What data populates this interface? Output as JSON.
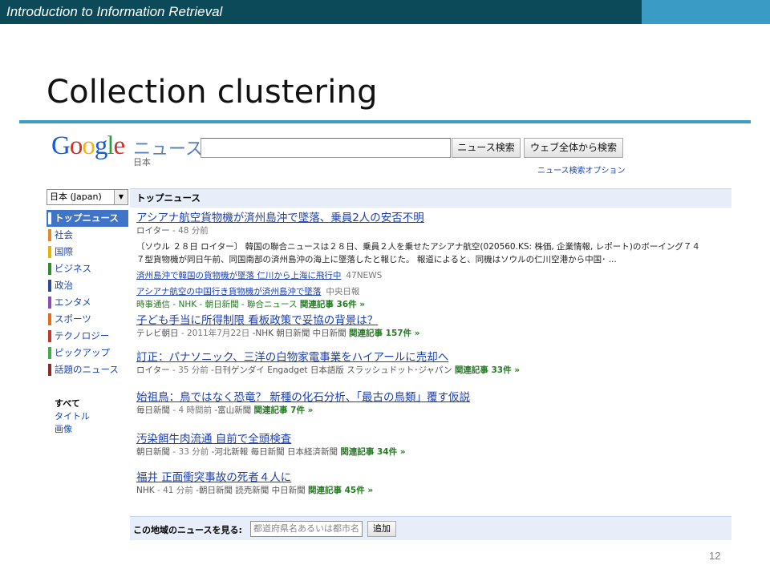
{
  "slide": {
    "course_title": "Introduction to Information Retrieval",
    "title": "Collection clustering",
    "page_number": "12",
    "colors": {
      "bar": "#0c4a5a",
      "accent": "#3a9cc4"
    }
  },
  "google_news": {
    "logo": "Google",
    "section": "ニュース",
    "edition": "日本",
    "search_value": "",
    "news_search_button": "ニュース検索",
    "web_search_button": "ウェブ全体から検索",
    "search_options_link": "ニュース検索オプション",
    "edition_select": "日本 (Japan)",
    "nav": [
      {
        "label": "トップニュース",
        "color": "#3f74c8",
        "active": true
      },
      {
        "label": "社会",
        "color": "#e08a2b"
      },
      {
        "label": "国際",
        "color": "#e8b400"
      },
      {
        "label": "ビジネス",
        "color": "#2e8b2e"
      },
      {
        "label": "政治",
        "color": "#2c4a9c"
      },
      {
        "label": "エンタメ",
        "color": "#8a4fb0"
      },
      {
        "label": "スポーツ",
        "color": "#e86a1c"
      },
      {
        "label": "テクノロジー",
        "color": "#c0392b"
      },
      {
        "label": "ピックアップ",
        "color": "#3fae49"
      },
      {
        "label": "話題のニュース",
        "color": "#8b2a2a"
      }
    ],
    "view_options": [
      "すべて",
      "タイトル",
      "画像"
    ],
    "top_news_header": "トップニュース",
    "stories": [
      {
        "title": "アシアナ航空貨物機が済州島沖で墜落、乗員2人の安否不明",
        "source": "ロイター",
        "time": "48 分前",
        "snippet_1": "〔ソウル ２８日 ロイター〕 韓国の聯合ニュースは２８日、乗員２人を乗せたアシアナ航空(020560.KS: 株価, 企業情報, レポート)のボーイング７４",
        "snippet_2": "７型貨物機が同日午前、同国南部の済州島沖の海上に墜落したと報じた。 報道によると、同機はソウルの仁川空港から中国･ ...",
        "sub_links": [
          {
            "text": "済州島沖で韓国の貨物機が墜落 仁川から上海に飛行中",
            "source": "47NEWS"
          },
          {
            "text": "アシアナ航空の中国行き貨物機が済州島沖で墜落",
            "source": "中央日報"
          }
        ],
        "other_sources": "時事通信 - NHK - 朝日新聞 - 聯合ニュース",
        "related": "関連記事 36件 »"
      },
      {
        "title": "子ども手当に所得制限 看板政策で妥協の背景は？",
        "source": "テレビ朝日",
        "time": "2011年7月22日",
        "more_sources": "-NHK  朝日新聞  中日新聞",
        "related": "関連記事 157件 »"
      },
      {
        "title": "訂正：パナソニック、三洋の白物家電事業をハイアールに売却へ",
        "source": "ロイター",
        "time": "35 分前",
        "more_sources": "-日刊ゲンダイ  Engadget 日本語版  スラッシュドット･ジャパン",
        "related": "関連記事 33件 »"
      },
      {
        "title": "始祖鳥：鳥ではなく恐竜？ 新種の化石分析、「最古の鳥類」覆す仮説",
        "source": "毎日新聞",
        "time": "4 時間前",
        "more_sources": "-富山新聞",
        "related": "関連記事 7件 »"
      },
      {
        "title": "汚染餌牛肉流通 自前で全頭検査",
        "source": "朝日新聞",
        "time": "33 分前",
        "more_sources": "-河北新報  毎日新聞  日本経済新聞",
        "related": "関連記事 34件 »"
      },
      {
        "title": "福井 正面衝突事故の死者４人に",
        "source": "NHK",
        "time": "41 分前",
        "more_sources": "-朝日新聞  読売新聞  中日新聞",
        "related": "関連記事 45件 »"
      }
    ],
    "local": {
      "label": "この地域のニュースを見る:",
      "placeholder": "都道府県名あるいは都市名",
      "button": "追加"
    }
  }
}
